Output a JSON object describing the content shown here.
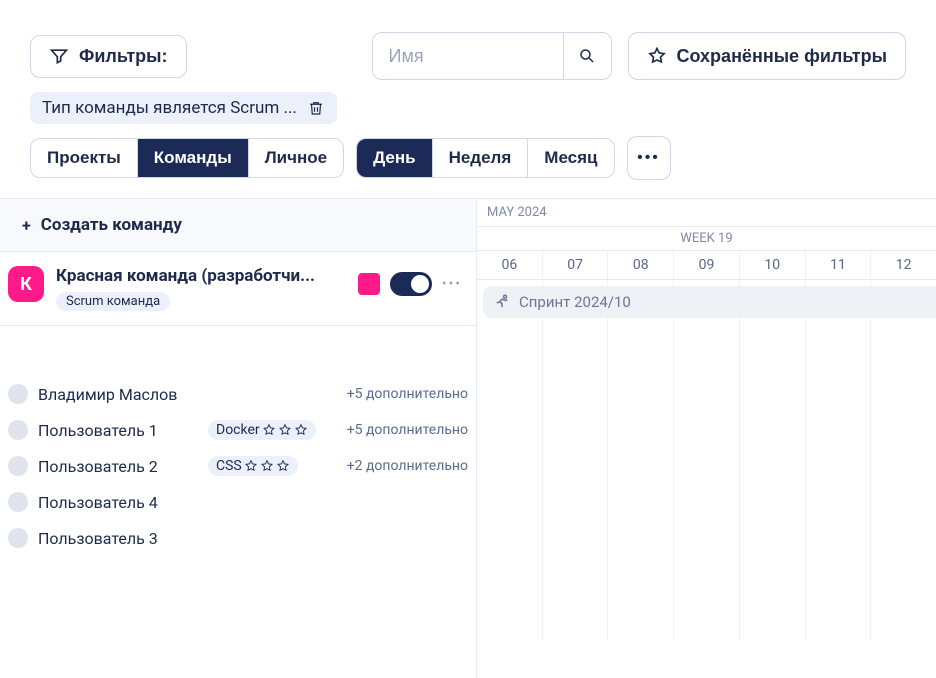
{
  "topbar": {
    "filters_label": "Фильтры:",
    "search_placeholder": "Имя",
    "saved_label": "Сохранённые фильтры"
  },
  "filter_chip": {
    "label": "Тип команды является Scrum ..."
  },
  "view_tabs": {
    "projects": "Проекты",
    "teams": "Команды",
    "personal": "Личное"
  },
  "range_tabs": {
    "day": "День",
    "week": "Неделя",
    "month": "Месяц"
  },
  "left": {
    "create_label": "Создать команду",
    "team": {
      "avatar_letter": "К",
      "title": "Красная команда (разработчи...",
      "badge": "Scrum команда"
    },
    "members": [
      {
        "name": "Владимир Маслов",
        "skill": null,
        "extra": "+5 дополнительно"
      },
      {
        "name": "Пользователь 1",
        "skill": "Docker",
        "extra": "+5 дополнительно"
      },
      {
        "name": "Пользователь 2",
        "skill": "CSS",
        "extra": "+2 дополнительно"
      },
      {
        "name": "Пользователь 4",
        "skill": null,
        "extra": null
      },
      {
        "name": "Пользователь 3",
        "skill": null,
        "extra": null
      }
    ]
  },
  "timeline": {
    "month_label": "MAY 2024",
    "week_label": "WEEK 19",
    "days": [
      "06",
      "07",
      "08",
      "09",
      "10",
      "11",
      "12"
    ],
    "sprint_label": "Спринт 2024/10"
  }
}
